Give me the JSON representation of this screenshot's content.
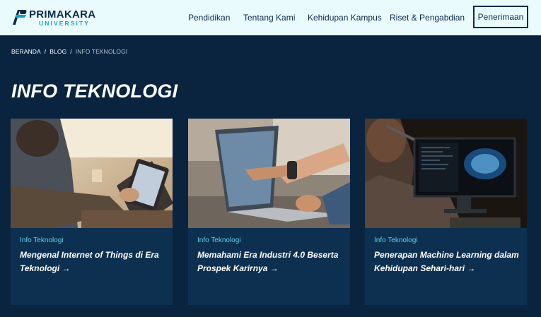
{
  "header": {
    "logo_name": "PRIMAKARA",
    "logo_sub": "UNIVERSITY",
    "nav": [
      "Pendidikan",
      "Tentang Kami",
      "Kehidupan Kampus",
      "Riset & Pengabdian"
    ],
    "cta": "Penerimaan"
  },
  "breadcrumb": [
    "BERANDA",
    "BLOG",
    "INFO TEKNOLOGI"
  ],
  "page_title": "INFO TEKNOLOGI",
  "cards": [
    {
      "category": "Info Teknologi",
      "title": "Mengenal Internet of Things di Era Teknologi →"
    },
    {
      "category": "Info Teknologi",
      "title": "Memahami Era Industri 4.0 Beserta Prospek Karirnya →"
    },
    {
      "category": "Info Teknologi",
      "title": "Penerapan Machine Learning dalam Kehidupan Sehari-hari →"
    }
  ],
  "colors": {
    "header_bg": "#eafbfd",
    "page_bg": "#0a2440",
    "card_bg": "#0d3050",
    "accent": "#5ed0ea",
    "brand_dark": "#0b2a4a"
  }
}
